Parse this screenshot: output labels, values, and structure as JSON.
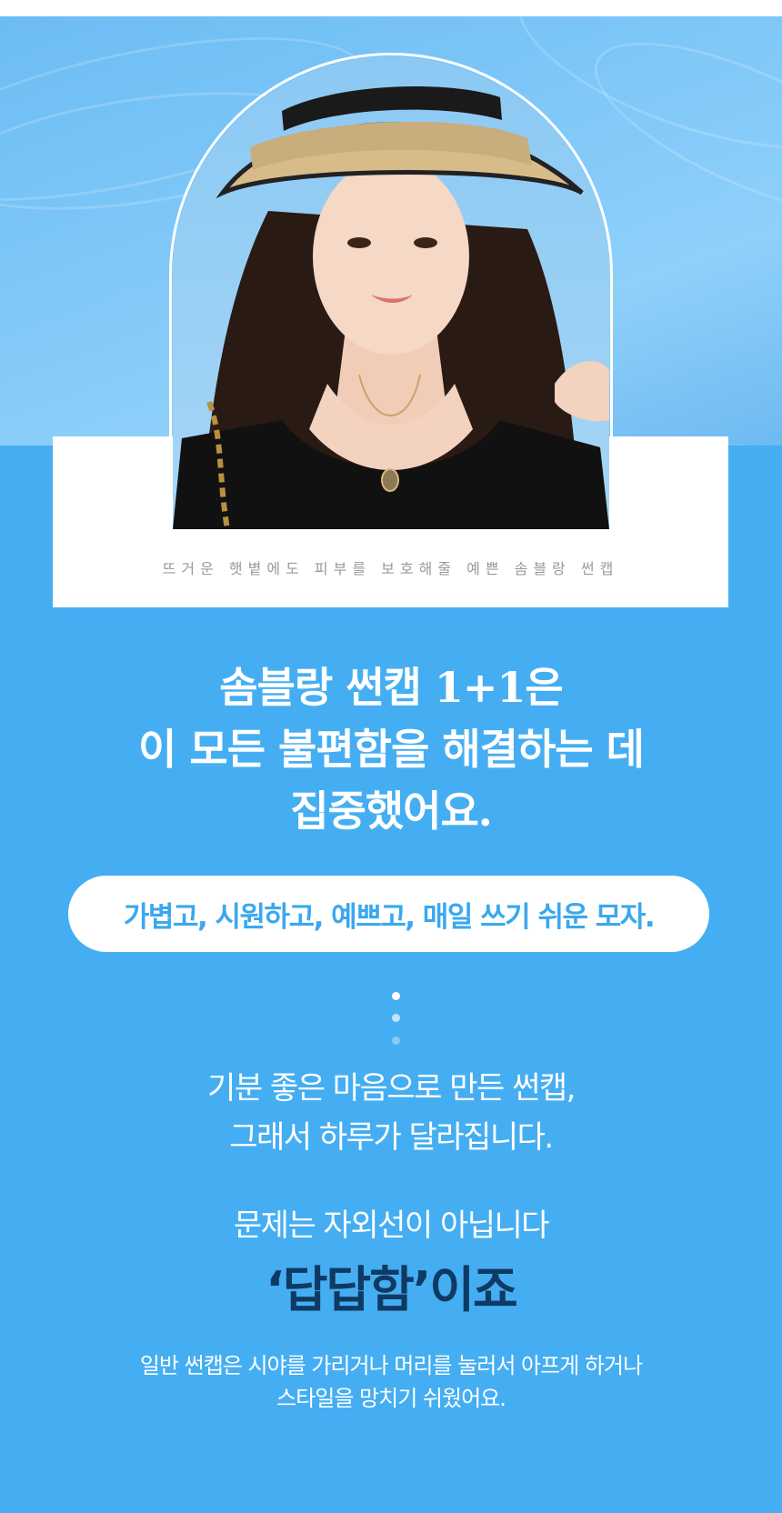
{
  "hero": {
    "caption": "뜨거운 햇볕에도 피부를 보호해줄 예쁜 솜블랑 썬캡"
  },
  "headline": {
    "lines": [
      "솜블랑 썬캡 1+1은",
      "이 모든 불편함을 해결하는 데",
      "집중했어요."
    ]
  },
  "pill": {
    "text": "가볍고, 시원하고, 예쁘고, 매일 쓰기 쉬운 모자."
  },
  "mood": {
    "lines": [
      "기분 좋은 마음으로 만든 썬캡,",
      "그래서 하루가 달라집니다."
    ]
  },
  "problem": {
    "lead": "문제는 자외선이 아닙니다",
    "emphasis": "‘답답함’이죠"
  },
  "body": {
    "lines": [
      "일반 썬캡은 시야를 가리거나 머리를 눌러서 아프게 하거나",
      "스타일을 망치기 쉬웠어요."
    ]
  },
  "colors": {
    "primary_blue": "#45aef2",
    "pill_text": "#3aa8ee",
    "emphasis_navy": "#0e3a63"
  },
  "icons": {
    "photo": "woman-wearing-straw-sun-visor"
  }
}
